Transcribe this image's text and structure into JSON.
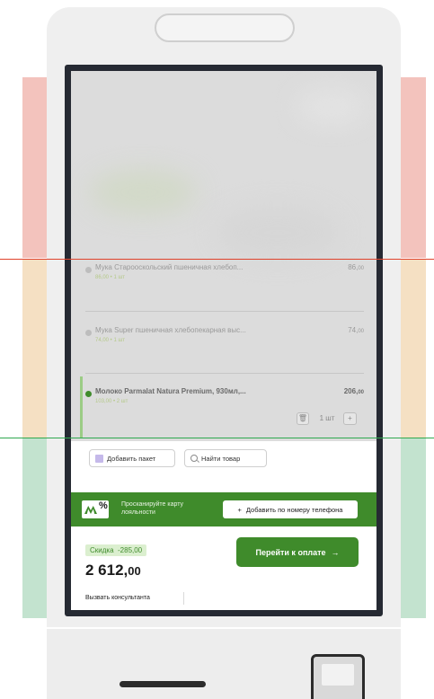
{
  "colors": {
    "brand_green": "#3f8b2b",
    "zone_red": "#f3c3bd",
    "zone_orange": "#f5e0c3",
    "zone_green": "#c3e3cf",
    "zone_line_red": "#e0422b",
    "zone_line_green": "#2fa84f"
  },
  "cart": {
    "items": [
      {
        "name": "Мука Старооскольский пшеничная хлебоп...",
        "sub": "86,00 • 1 шт",
        "price_int": "86,",
        "price_dec": "00",
        "active": false
      },
      {
        "name": "Мука Super пшеничная хлебопекарная выс...",
        "sub": "74,00 • 1 шт",
        "price_int": "74,",
        "price_dec": "00",
        "active": false
      },
      {
        "name": "Молоко Parmalat Natura Premium, 930мл,...",
        "sub": "103,00 • 2 шт",
        "price_int": "206,",
        "price_dec": "00",
        "active": true
      }
    ],
    "qty_minus": "🗑",
    "qty_value": "1 шт",
    "qty_plus": "+"
  },
  "actions": {
    "add_bag": "Добавить пакет",
    "find_item": "Найти товар"
  },
  "loyalty": {
    "icon_text": "%",
    "text": "Просканируйте карту лояльности",
    "phone_button": "Добавить по номеру телефона",
    "plus": "+"
  },
  "totals": {
    "discount_label": "Скидка",
    "discount_value": "-285,00",
    "total_int": "2 612,",
    "total_dec": "00",
    "pay_button": "Перейти к оплате",
    "arrow": "→"
  },
  "footer": {
    "consultant": "Вызвать консультанта"
  }
}
